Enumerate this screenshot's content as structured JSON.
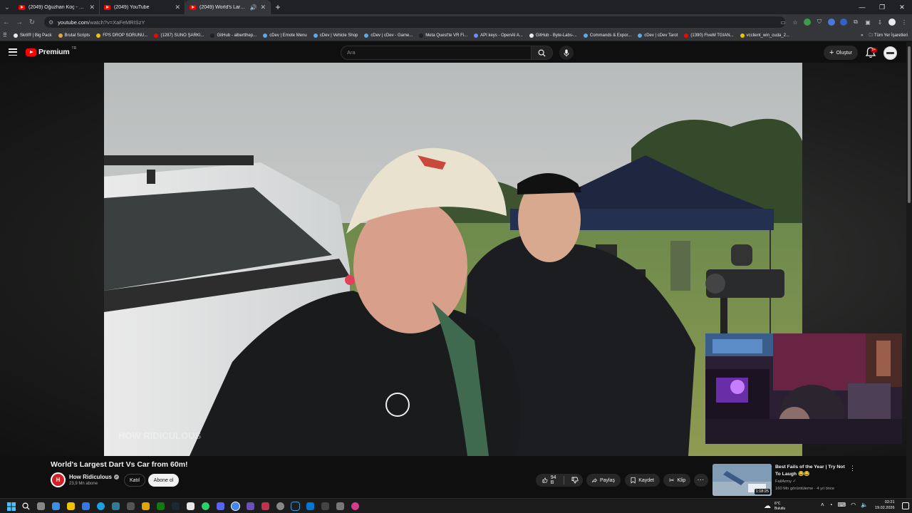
{
  "browser": {
    "tabs": [
      {
        "title": "(2049) Oğuzhan Koç - Domuz",
        "active": false,
        "audio": false
      },
      {
        "title": "(2049) YouTube",
        "active": false,
        "audio": false
      },
      {
        "title": "(2049) World's Largest Dart",
        "active": true,
        "audio": true
      }
    ],
    "url_host": "youtube.com",
    "url_path": "/watch?v=XaFeMRISzY",
    "bookmarks": [
      {
        "label": "Skril® | Big Pack",
        "color": "#e8eaed"
      },
      {
        "label": "Brutal Scripts",
        "color": "#e8a33d"
      },
      {
        "label": "FPS DROP SORUNU...",
        "color": "#f2c200"
      },
      {
        "label": "(1287) SUNO ŞARKI...",
        "color": "#ff0000"
      },
      {
        "label": "GitHub - albertthep...",
        "color": "#202124"
      },
      {
        "label": "cDev | Emote Menu",
        "color": "#5aa9e6"
      },
      {
        "label": "cDev | Vehicle Shop",
        "color": "#5aa9e6"
      },
      {
        "label": "cDev | cDev - Game...",
        "color": "#5aa9e6"
      },
      {
        "label": "Meta Quest'te VR Fi...",
        "color": "#202124"
      },
      {
        "label": "API keys - OpenAI A...",
        "color": "#6b8cff"
      },
      {
        "label": "GitHub - Byte-Labs-...",
        "color": "#e8eaed"
      },
      {
        "label": "Commands & Expor...",
        "color": "#5aa9e6"
      },
      {
        "label": "cDev | cDev Tarot",
        "color": "#5aa9e6"
      },
      {
        "label": "(1390) FiveM TGIAN...",
        "color": "#ff0000"
      },
      {
        "label": "vcclient_win_cuda_2...",
        "color": "#f2c200"
      }
    ],
    "all_bookmarks": "Tüm Yer İşaretleri"
  },
  "youtube": {
    "logo_text": "Premium",
    "logo_country": "TR",
    "search_placeholder": "Ara",
    "create_label": "Oluştur",
    "notif_count": "9+",
    "video": {
      "title": "World's Largest Dart Vs Car from 60m!",
      "channel": "How Ridiculous",
      "channel_initials": "H",
      "subscribers": "23,9 Mn abone",
      "join_label": "Katıl",
      "subscribe_label": "Abone ol",
      "likes": "94 B",
      "share_label": "Paylaş",
      "save_label": "Kaydet",
      "clip_label": "Klip",
      "watermark": "HOW RIDICULOUS"
    },
    "recommendation": {
      "title": "Best Fails of the Year | Try Not To Laugh 😂😂",
      "channel": "FailArmy",
      "meta": "160 Mn görüntüleme · 4 yıl önce",
      "duration": "1:18:25"
    }
  },
  "taskbar": {
    "weather_temp": "6°C",
    "weather_desc": "Bulutlu",
    "time": "02:21",
    "date": "19.02.2026"
  }
}
